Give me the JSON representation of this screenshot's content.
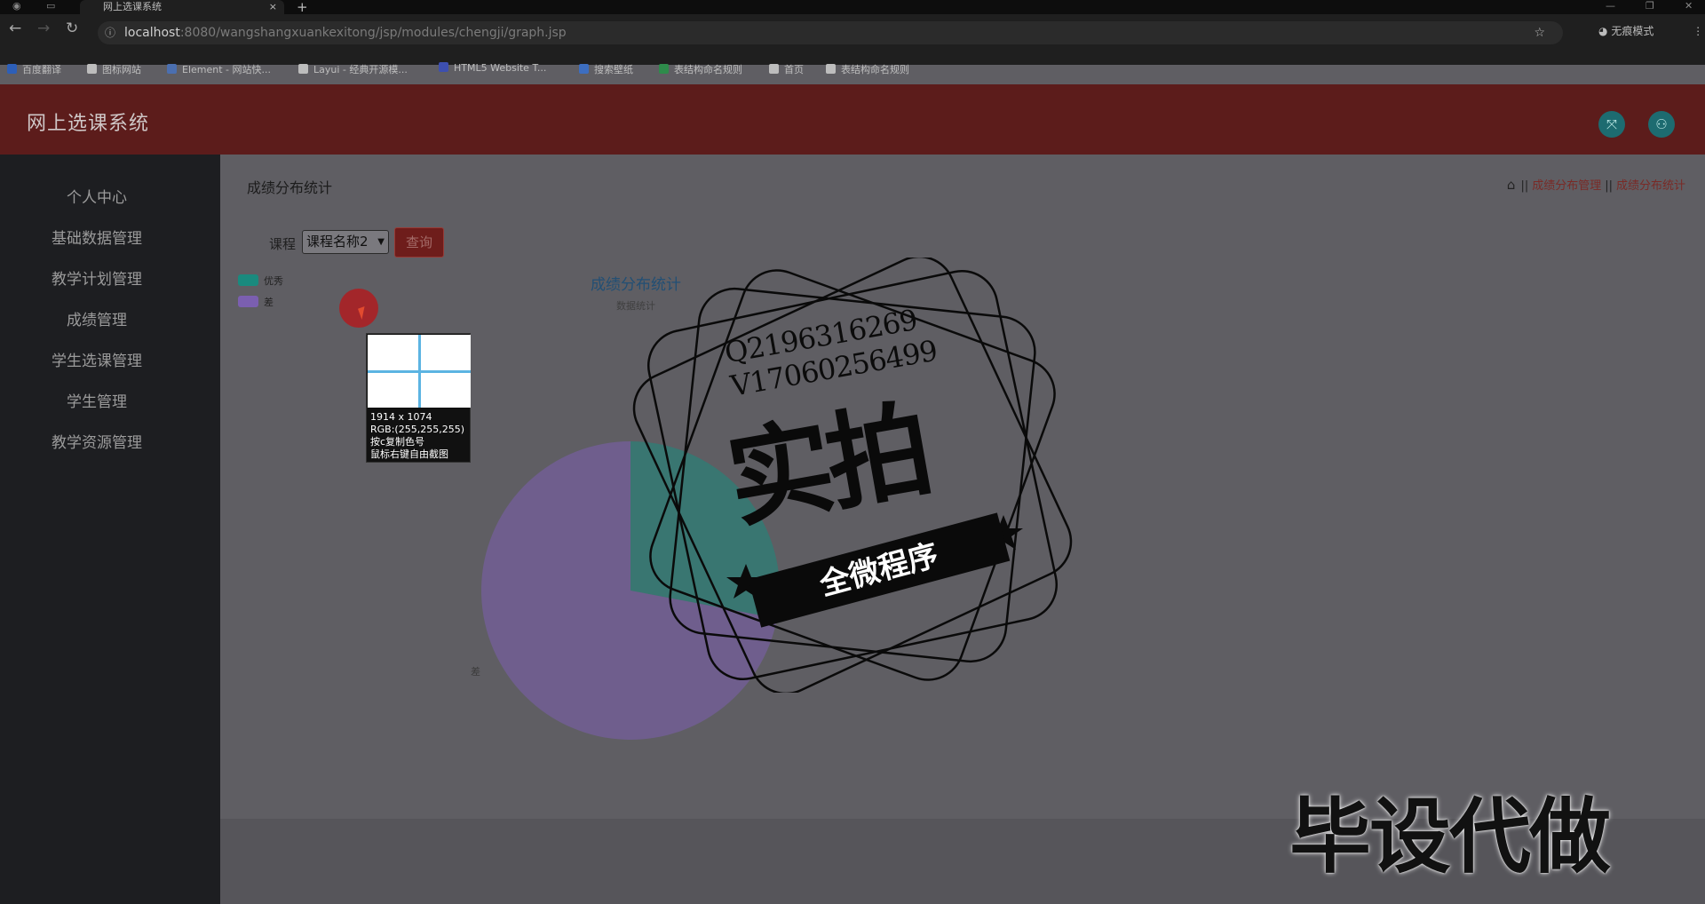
{
  "browser": {
    "tab_title": "网上选课系统",
    "tab_close": "×",
    "new_tab": "+",
    "url_host": "localhost",
    "url_path": ":8080/wangshangxuankexitong/jsp/modules/chengji/graph.jsp",
    "incognito_label": "无痕模式",
    "bookmarks": [
      {
        "label": "百度翻译",
        "color": "#2d5fb8"
      },
      {
        "label": "图标网站",
        "color": "#bdbdbd"
      },
      {
        "label": "Element - 网站快...",
        "color": "#4b6fb0"
      },
      {
        "label": "Layui - 经典开源模...",
        "color": "#bdbdbd"
      },
      {
        "label": "HTML5 Website T...",
        "color": "#3d4fb0"
      },
      {
        "label": "搜索壁纸",
        "color": "#3d6ec0"
      },
      {
        "label": "表结构命名规则",
        "color": "#2e8b4b"
      },
      {
        "label": "首页",
        "color": "#bdbdbd"
      },
      {
        "label": "表结构命名规则",
        "color": "#bdbdbd"
      }
    ]
  },
  "app": {
    "brand": "网上选课系统",
    "header_colors": {
      "bar": "#5c1c1b",
      "buttons": "#1d6b70"
    }
  },
  "sidebar": {
    "items": [
      {
        "label": "个人中心"
      },
      {
        "label": "基础数据管理"
      },
      {
        "label": "教学计划管理"
      },
      {
        "label": "成绩管理"
      },
      {
        "label": "学生选课管理"
      },
      {
        "label": "学生管理"
      },
      {
        "label": "教学资源管理"
      }
    ]
  },
  "page": {
    "title": "成绩分布统计",
    "breadcrumb": [
      "成绩分布管理",
      "成绩分布统计"
    ],
    "breadcrumb_sep": "||",
    "filter_label": "课程",
    "filter_value": "课程名称2",
    "query_button": "查询"
  },
  "chart_data": {
    "type": "pie",
    "title": "成绩分布统计",
    "subtitle": "数据统计",
    "legend_position": "top-left",
    "slices": [
      {
        "name": "优秀",
        "value": 28,
        "color": "#1a8a7e"
      },
      {
        "name": "差",
        "value": 72,
        "color": "#7b5fb0"
      }
    ],
    "outer_label": "差"
  },
  "color_picker": {
    "lines": [
      "1914 x 1074",
      "RGB:(255,255,255)",
      "按c复制色号",
      "鼠标右键自由截图"
    ]
  },
  "watermark": {
    "contact": [
      "Q2196316269",
      "V17060256499"
    ],
    "big_text": "实拍",
    "band_text": "全微程序",
    "corner_text": "毕设代做"
  }
}
